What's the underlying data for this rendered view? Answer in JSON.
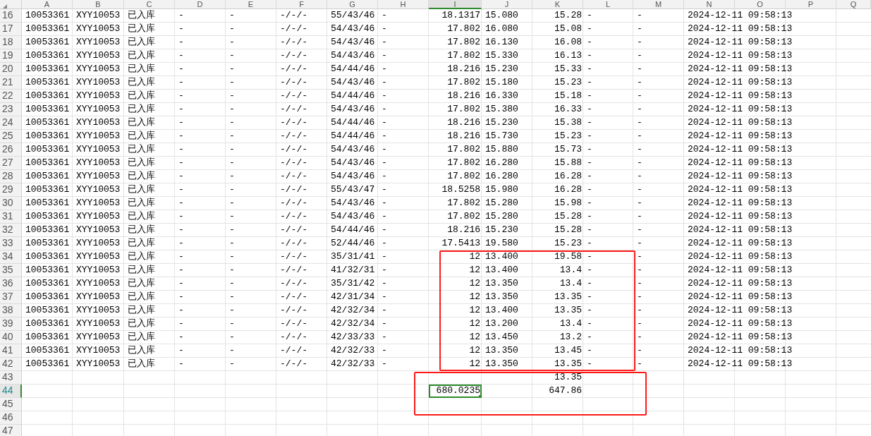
{
  "columns": [
    {
      "label": "A",
      "selected": false,
      "kind": "text"
    },
    {
      "label": "B",
      "selected": false,
      "kind": "text"
    },
    {
      "label": "C",
      "selected": false,
      "kind": "text"
    },
    {
      "label": "D",
      "selected": false,
      "kind": "text"
    },
    {
      "label": "E",
      "selected": false,
      "kind": "text"
    },
    {
      "label": "F",
      "selected": false,
      "kind": "text"
    },
    {
      "label": "G",
      "selected": false,
      "kind": "text"
    },
    {
      "label": "H",
      "selected": false,
      "kind": "text"
    },
    {
      "label": "I",
      "selected": true,
      "kind": "number"
    },
    {
      "label": "J",
      "selected": false,
      "kind": "text"
    },
    {
      "label": "K",
      "selected": false,
      "kind": "number"
    },
    {
      "label": "L",
      "selected": false,
      "kind": "text"
    },
    {
      "label": "M",
      "selected": false,
      "kind": "text"
    },
    {
      "label": "N",
      "selected": false,
      "kind": "text"
    },
    {
      "label": "O",
      "selected": false
    },
    {
      "label": "P",
      "selected": false
    },
    {
      "label": "Q",
      "selected": false
    }
  ],
  "rows": [
    {
      "number": "16",
      "selected": false,
      "cells": {
        "A": "10053361",
        "B": "XYY10053",
        "C": "已入库",
        "D": "-",
        "E": "-",
        "F": "-/-/-",
        "G": "55/43/46",
        "H": "-",
        "I": "18.1317",
        "J": "15.080",
        "K": "15.28",
        "L": "-",
        "M": "-",
        "N": "2024-12-11 09:58:13"
      }
    },
    {
      "number": "17",
      "selected": false,
      "cells": {
        "A": "10053361",
        "B": "XYY10053",
        "C": "已入库",
        "D": "-",
        "E": "-",
        "F": "-/-/-",
        "G": "54/43/46",
        "H": "-",
        "I": "17.802",
        "J": "16.080",
        "K": "15.08",
        "L": "-",
        "M": "-",
        "N": "2024-12-11 09:58:13"
      }
    },
    {
      "number": "18",
      "selected": false,
      "cells": {
        "A": "10053361",
        "B": "XYY10053",
        "C": "已入库",
        "D": "-",
        "E": "-",
        "F": "-/-/-",
        "G": "54/43/46",
        "H": "-",
        "I": "17.802",
        "J": "16.130",
        "K": "16.08",
        "L": "-",
        "M": "-",
        "N": "2024-12-11 09:58:13"
      }
    },
    {
      "number": "19",
      "selected": false,
      "cells": {
        "A": "10053361",
        "B": "XYY10053",
        "C": "已入库",
        "D": "-",
        "E": "-",
        "F": "-/-/-",
        "G": "54/43/46",
        "H": "-",
        "I": "17.802",
        "J": "15.330",
        "K": "16.13",
        "L": "-",
        "M": "-",
        "N": "2024-12-11 09:58:13"
      }
    },
    {
      "number": "20",
      "selected": false,
      "cells": {
        "A": "10053361",
        "B": "XYY10053",
        "C": "已入库",
        "D": "-",
        "E": "-",
        "F": "-/-/-",
        "G": "54/44/46",
        "H": "-",
        "I": "18.216",
        "J": "15.230",
        "K": "15.33",
        "L": "-",
        "M": "-",
        "N": "2024-12-11 09:58:13"
      }
    },
    {
      "number": "21",
      "selected": false,
      "cells": {
        "A": "10053361",
        "B": "XYY10053",
        "C": "已入库",
        "D": "-",
        "E": "-",
        "F": "-/-/-",
        "G": "54/43/46",
        "H": "-",
        "I": "17.802",
        "J": "15.180",
        "K": "15.23",
        "L": "-",
        "M": "-",
        "N": "2024-12-11 09:58:13"
      }
    },
    {
      "number": "22",
      "selected": false,
      "cells": {
        "A": "10053361",
        "B": "XYY10053",
        "C": "已入库",
        "D": "-",
        "E": "-",
        "F": "-/-/-",
        "G": "54/44/46",
        "H": "-",
        "I": "18.216",
        "J": "16.330",
        "K": "15.18",
        "L": "-",
        "M": "-",
        "N": "2024-12-11 09:58:13"
      }
    },
    {
      "number": "23",
      "selected": false,
      "cells": {
        "A": "10053361",
        "B": "XYY10053",
        "C": "已入库",
        "D": "-",
        "E": "-",
        "F": "-/-/-",
        "G": "54/43/46",
        "H": "-",
        "I": "17.802",
        "J": "15.380",
        "K": "16.33",
        "L": "-",
        "M": "-",
        "N": "2024-12-11 09:58:13"
      }
    },
    {
      "number": "24",
      "selected": false,
      "cells": {
        "A": "10053361",
        "B": "XYY10053",
        "C": "已入库",
        "D": "-",
        "E": "-",
        "F": "-/-/-",
        "G": "54/44/46",
        "H": "-",
        "I": "18.216",
        "J": "15.230",
        "K": "15.38",
        "L": "-",
        "M": "-",
        "N": "2024-12-11 09:58:13"
      }
    },
    {
      "number": "25",
      "selected": false,
      "cells": {
        "A": "10053361",
        "B": "XYY10053",
        "C": "已入库",
        "D": "-",
        "E": "-",
        "F": "-/-/-",
        "G": "54/44/46",
        "H": "-",
        "I": "18.216",
        "J": "15.730",
        "K": "15.23",
        "L": "-",
        "M": "-",
        "N": "2024-12-11 09:58:13"
      }
    },
    {
      "number": "26",
      "selected": false,
      "cells": {
        "A": "10053361",
        "B": "XYY10053",
        "C": "已入库",
        "D": "-",
        "E": "-",
        "F": "-/-/-",
        "G": "54/43/46",
        "H": "-",
        "I": "17.802",
        "J": "15.880",
        "K": "15.73",
        "L": "-",
        "M": "-",
        "N": "2024-12-11 09:58:13"
      }
    },
    {
      "number": "27",
      "selected": false,
      "cells": {
        "A": "10053361",
        "B": "XYY10053",
        "C": "已入库",
        "D": "-",
        "E": "-",
        "F": "-/-/-",
        "G": "54/43/46",
        "H": "-",
        "I": "17.802",
        "J": "16.280",
        "K": "15.88",
        "L": "-",
        "M": "-",
        "N": "2024-12-11 09:58:13"
      }
    },
    {
      "number": "28",
      "selected": false,
      "cells": {
        "A": "10053361",
        "B": "XYY10053",
        "C": "已入库",
        "D": "-",
        "E": "-",
        "F": "-/-/-",
        "G": "54/43/46",
        "H": "-",
        "I": "17.802",
        "J": "16.280",
        "K": "16.28",
        "L": "-",
        "M": "-",
        "N": "2024-12-11 09:58:13"
      }
    },
    {
      "number": "29",
      "selected": false,
      "cells": {
        "A": "10053361",
        "B": "XYY10053",
        "C": "已入库",
        "D": "-",
        "E": "-",
        "F": "-/-/-",
        "G": "55/43/47",
        "H": "-",
        "I": "18.5258",
        "J": "15.980",
        "K": "16.28",
        "L": "-",
        "M": "-",
        "N": "2024-12-11 09:58:13"
      }
    },
    {
      "number": "30",
      "selected": false,
      "cells": {
        "A": "10053361",
        "B": "XYY10053",
        "C": "已入库",
        "D": "-",
        "E": "-",
        "F": "-/-/-",
        "G": "54/43/46",
        "H": "-",
        "I": "17.802",
        "J": "15.280",
        "K": "15.98",
        "L": "-",
        "M": "-",
        "N": "2024-12-11 09:58:13"
      }
    },
    {
      "number": "31",
      "selected": false,
      "cells": {
        "A": "10053361",
        "B": "XYY10053",
        "C": "已入库",
        "D": "-",
        "E": "-",
        "F": "-/-/-",
        "G": "54/43/46",
        "H": "-",
        "I": "17.802",
        "J": "15.280",
        "K": "15.28",
        "L": "-",
        "M": "-",
        "N": "2024-12-11 09:58:13"
      }
    },
    {
      "number": "32",
      "selected": false,
      "cells": {
        "A": "10053361",
        "B": "XYY10053",
        "C": "已入库",
        "D": "-",
        "E": "-",
        "F": "-/-/-",
        "G": "54/44/46",
        "H": "-",
        "I": "18.216",
        "J": "15.230",
        "K": "15.28",
        "L": "-",
        "M": "-",
        "N": "2024-12-11 09:58:13"
      }
    },
    {
      "number": "33",
      "selected": false,
      "cells": {
        "A": "10053361",
        "B": "XYY10053",
        "C": "已入库",
        "D": "-",
        "E": "-",
        "F": "-/-/-",
        "G": "52/44/46",
        "H": "-",
        "I": "17.5413",
        "J": "19.580",
        "K": "15.23",
        "L": "-",
        "M": "-",
        "N": "2024-12-11 09:58:13"
      }
    },
    {
      "number": "34",
      "selected": false,
      "cells": {
        "A": "10053361",
        "B": "XYY10053",
        "C": "已入库",
        "D": "-",
        "E": "-",
        "F": "-/-/-",
        "G": "35/31/41",
        "H": "-",
        "I": "12",
        "J": "13.400",
        "K": "19.58",
        "L": "-",
        "M": "-",
        "N": "2024-12-11 09:58:13"
      }
    },
    {
      "number": "35",
      "selected": false,
      "cells": {
        "A": "10053361",
        "B": "XYY10053",
        "C": "已入库",
        "D": "-",
        "E": "-",
        "F": "-/-/-",
        "G": "41/32/31",
        "H": "-",
        "I": "12",
        "J": "13.400",
        "K": "13.4",
        "L": "-",
        "M": "-",
        "N": "2024-12-11 09:58:13"
      }
    },
    {
      "number": "36",
      "selected": false,
      "cells": {
        "A": "10053361",
        "B": "XYY10053",
        "C": "已入库",
        "D": "-",
        "E": "-",
        "F": "-/-/-",
        "G": "35/31/42",
        "H": "-",
        "I": "12",
        "J": "13.350",
        "K": "13.4",
        "L": "-",
        "M": "-",
        "N": "2024-12-11 09:58:13"
      }
    },
    {
      "number": "37",
      "selected": false,
      "cells": {
        "A": "10053361",
        "B": "XYY10053",
        "C": "已入库",
        "D": "-",
        "E": "-",
        "F": "-/-/-",
        "G": "42/31/34",
        "H": "-",
        "I": "12",
        "J": "13.350",
        "K": "13.35",
        "L": "-",
        "M": "-",
        "N": "2024-12-11 09:58:13"
      }
    },
    {
      "number": "38",
      "selected": false,
      "cells": {
        "A": "10053361",
        "B": "XYY10053",
        "C": "已入库",
        "D": "-",
        "E": "-",
        "F": "-/-/-",
        "G": "42/32/34",
        "H": "-",
        "I": "12",
        "J": "13.400",
        "K": "13.35",
        "L": "-",
        "M": "-",
        "N": "2024-12-11 09:58:13"
      }
    },
    {
      "number": "39",
      "selected": false,
      "cells": {
        "A": "10053361",
        "B": "XYY10053",
        "C": "已入库",
        "D": "-",
        "E": "-",
        "F": "-/-/-",
        "G": "42/32/34",
        "H": "-",
        "I": "12",
        "J": "13.200",
        "K": "13.4",
        "L": "-",
        "M": "-",
        "N": "2024-12-11 09:58:13"
      }
    },
    {
      "number": "40",
      "selected": false,
      "cells": {
        "A": "10053361",
        "B": "XYY10053",
        "C": "已入库",
        "D": "-",
        "E": "-",
        "F": "-/-/-",
        "G": "42/33/33",
        "H": "-",
        "I": "12",
        "J": "13.450",
        "K": "13.2",
        "L": "-",
        "M": "-",
        "N": "2024-12-11 09:58:13"
      }
    },
    {
      "number": "41",
      "selected": false,
      "cells": {
        "A": "10053361",
        "B": "XYY10053",
        "C": "已入库",
        "D": "-",
        "E": "-",
        "F": "-/-/-",
        "G": "42/32/33",
        "H": "-",
        "I": "12",
        "J": "13.350",
        "K": "13.45",
        "L": "-",
        "M": "-",
        "N": "2024-12-11 09:58:13"
      }
    },
    {
      "number": "42",
      "selected": false,
      "cells": {
        "A": "10053361",
        "B": "XYY10053",
        "C": "已入库",
        "D": "-",
        "E": "-",
        "F": "-/-/-",
        "G": "42/32/33",
        "H": "-",
        "I": "12",
        "J": "13.350",
        "K": "13.35",
        "L": "-",
        "M": "-",
        "N": "2024-12-11 09:58:13"
      }
    },
    {
      "number": "43",
      "selected": false,
      "cells": {
        "K": "13.35"
      }
    },
    {
      "number": "44",
      "selected": true,
      "cells": {
        "I": {
          "text": "680.0235",
          "selected": true
        },
        "K": "647.86"
      }
    },
    {
      "number": "45",
      "selected": false,
      "cells": {}
    },
    {
      "number": "46",
      "selected": false,
      "cells": {}
    },
    {
      "number": "47",
      "selected": false,
      "cells": {}
    }
  ],
  "annotations": [
    {
      "kind": "outline"
    },
    {
      "kind": "outline"
    }
  ]
}
